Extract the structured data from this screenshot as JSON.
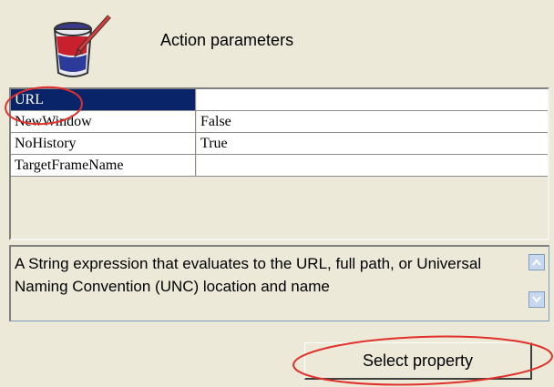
{
  "header": {
    "title": "Action parameters",
    "icon": "paint-bucket-icon"
  },
  "grid": {
    "rows": [
      {
        "name": "URL",
        "value": ""
      },
      {
        "name": "NewWindow",
        "value": "False"
      },
      {
        "name": "NoHistory",
        "value": "True"
      },
      {
        "name": "TargetFrameName",
        "value": ""
      }
    ]
  },
  "description": {
    "text": "A String expression that evaluates to the URL, full path, or Universal Naming Convention (UNC) location and name"
  },
  "buttons": {
    "select_property": "Select property"
  },
  "colors": {
    "selection": "#0a246a",
    "annotation": "#e0302a",
    "background": "#ece9d8"
  }
}
